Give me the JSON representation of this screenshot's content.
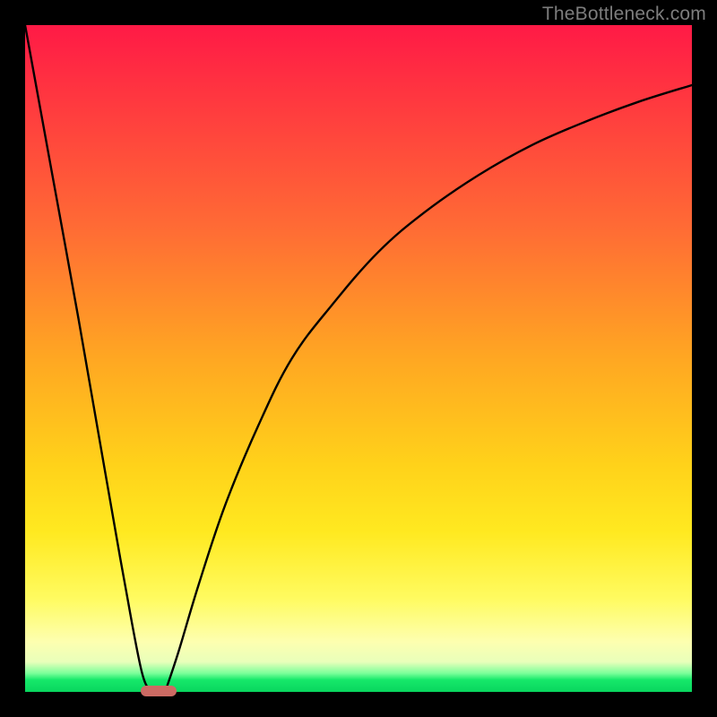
{
  "watermark": "TheBottleneck.com",
  "chart_data": {
    "type": "line",
    "title": "",
    "xlabel": "",
    "ylabel": "",
    "xlim": [
      0,
      100
    ],
    "ylim": [
      0,
      100
    ],
    "grid": false,
    "background_gradient": {
      "top": "#ff1a46",
      "mid_upper": "#ff6a35",
      "mid": "#ffd21a",
      "mid_lower": "#fffb60",
      "bottom": "#09d65e"
    },
    "series": [
      {
        "name": "left-branch",
        "x": [
          0,
          4,
          8,
          12,
          15,
          17.5,
          19
        ],
        "values": [
          100,
          78,
          56,
          33,
          16,
          3,
          0
        ]
      },
      {
        "name": "right-branch",
        "x": [
          21,
          23,
          26,
          30,
          35,
          40,
          46,
          53,
          60,
          68,
          76,
          84,
          92,
          100
        ],
        "values": [
          0,
          6,
          16,
          28,
          40,
          50,
          58,
          66,
          72,
          77.5,
          82,
          85.5,
          88.5,
          91
        ]
      }
    ],
    "marker": {
      "name": "optimal-point",
      "x_center": 20,
      "y": 0,
      "width_pct": 5.4,
      "color": "#cc6a63"
    }
  }
}
